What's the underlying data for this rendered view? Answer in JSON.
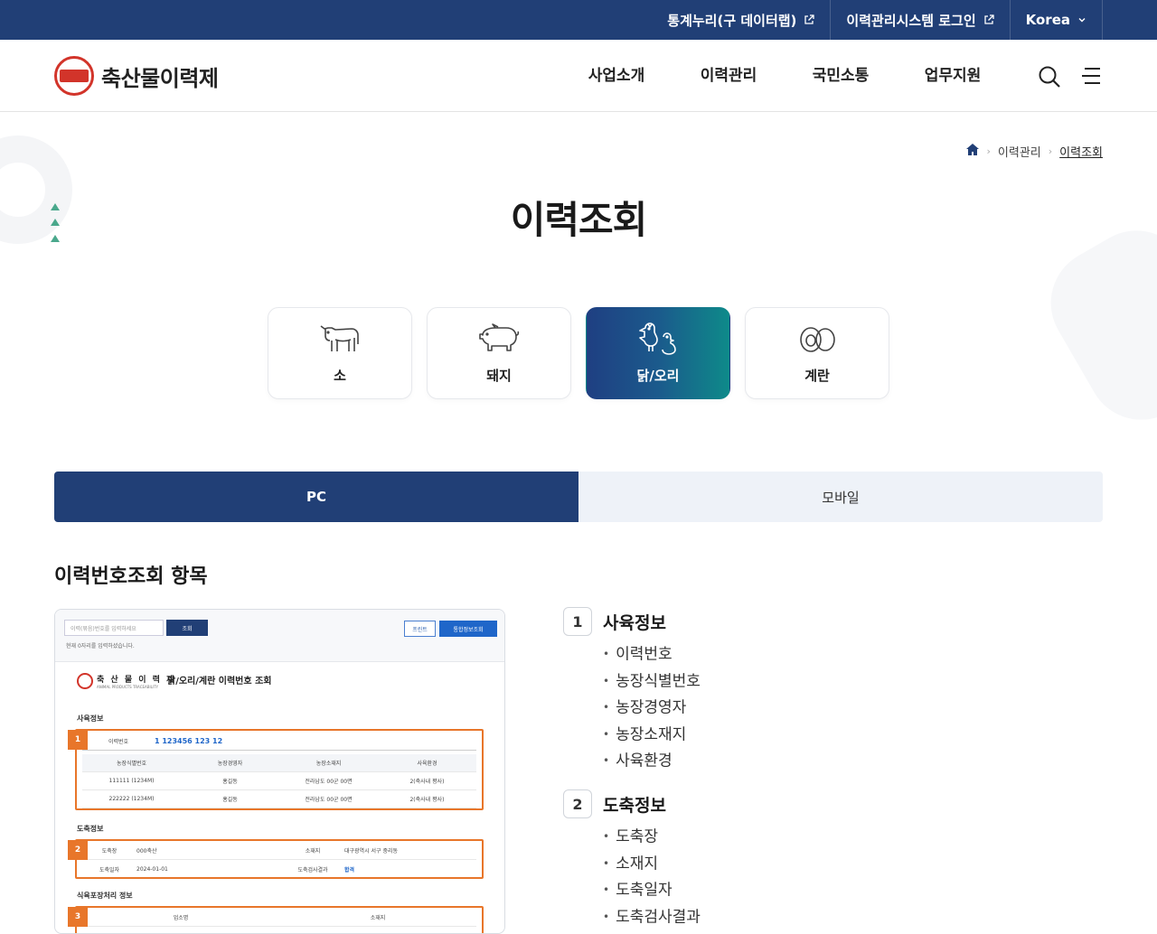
{
  "topbar": {
    "links": [
      {
        "label": "통계누리(구 데이터랩)",
        "icon": "external-link-icon"
      },
      {
        "label": "이력관리시스템 로그인",
        "icon": "external-link-icon"
      }
    ],
    "language": "Korea"
  },
  "header": {
    "logo_text": "축산물이력제",
    "nav": [
      "사업소개",
      "이력관리",
      "국민소통",
      "업무지원"
    ],
    "icons": [
      "search-icon",
      "menu-icon"
    ]
  },
  "breadcrumb": {
    "items": [
      "이력관리",
      "이력조회"
    ]
  },
  "page": {
    "title": "이력조회"
  },
  "animal_tabs": [
    {
      "label": "소",
      "icon": "cow-icon",
      "active": false
    },
    {
      "label": "돼지",
      "icon": "pig-icon",
      "active": false
    },
    {
      "label": "닭/오리",
      "icon": "chicken-duck-icon",
      "active": true
    },
    {
      "label": "계란",
      "icon": "egg-icon",
      "active": false
    }
  ],
  "view_tabs": [
    {
      "label": "PC",
      "active": true
    },
    {
      "label": "모바일",
      "active": false
    }
  ],
  "section_title": "이력번호조회 항목",
  "mock": {
    "search_placeholder": "이력(묶음)번호를 입력하세요",
    "search_button": "조회",
    "hint": "현재 0자리를 입력하셨습니다.",
    "print_button": "프린트",
    "integrated_button": "통합정보조회",
    "logo_name": "축 산 물 이 력 제",
    "logo_sub": "ANIMAL PRODUCTS TRACEABILITY",
    "heading": "닭/오리/계란 이력번호 조회",
    "sections": [
      {
        "title": "사육정보",
        "number": "1"
      },
      {
        "title": "도축정보",
        "number": "2"
      },
      {
        "title": "식육포장처리 정보",
        "number": "3"
      }
    ],
    "trace_label": "이력번호",
    "trace_value": "1 123456 123 12",
    "farm_headers": [
      "농장식별번호",
      "농장경영자",
      "농장소재지",
      "사육환경"
    ],
    "farm_rows": [
      [
        "111111 (1234M)",
        "홍길동",
        "전라남도 00군 00면",
        "2(축사내 평사)"
      ],
      [
        "222222 (1234M)",
        "홍길동",
        "전라남도 00군 00면",
        "2(축사내 평사)"
      ]
    ],
    "slaughter": {
      "place_label": "도축장",
      "place_value": "000축산",
      "addr_label": "소재지",
      "addr_value": "대구광역시 서구 중리동",
      "date_label": "도축일자",
      "date_value": "2024-01-01",
      "result_label": "도축검사결과",
      "result_value": "합격"
    },
    "pack_headers": [
      "업소명",
      "소재지"
    ]
  },
  "info_groups": [
    {
      "number": "1",
      "title": "사육정보",
      "items": [
        "이력번호",
        "농장식별번호",
        "농장경영자",
        "농장소재지",
        "사육환경"
      ]
    },
    {
      "number": "2",
      "title": "도축정보",
      "items": [
        "도축장",
        "소재지",
        "도축일자",
        "도축검사결과"
      ]
    }
  ],
  "colors": {
    "primary": "#213f76",
    "accent_orange": "#e8762a",
    "active_gradient_end": "#0e8a8a"
  }
}
